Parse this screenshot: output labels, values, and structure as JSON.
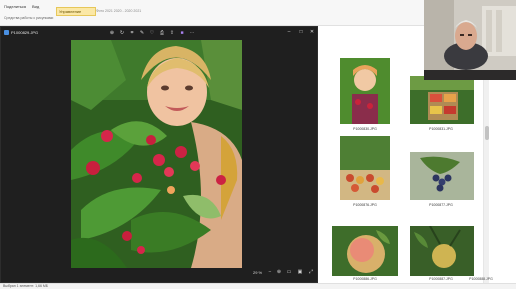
{
  "explorer": {
    "ribbon": {
      "tab1": "Поделиться",
      "tab2": "Вид",
      "highlight_tab": "Управление",
      "path_hint": "Фото 2021 2020 - 2020 2021",
      "sub1": "Средства работы с рисунками"
    },
    "thumbnails": [
      {
        "label": "P1000830.JPG"
      },
      {
        "label": "P1000831.JPG"
      },
      {
        "label": "P1000876.JPG"
      },
      {
        "label": "P1000877.JPG"
      },
      {
        "label": "P1000886.JPG"
      },
      {
        "label": "P1000885.JPG"
      }
    ],
    "bottom_labels": [
      "P1000876.JPG",
      "P1000883.JPG",
      "P1000884.JPG",
      "P1000885.JPG",
      "P1000886.JPG",
      "P1000887.JPG",
      "P1000888.JPG"
    ],
    "status": "Выбран 1 элемент: 1,66 МБ"
  },
  "viewer": {
    "title": "P1000829.JPG",
    "zoom": "29 %",
    "toolbar_icons": [
      "zoom-in-icon",
      "rotate-icon",
      "crop-icon",
      "edit-icon",
      "favorite-icon",
      "print-icon",
      "share-icon",
      "app-icon",
      "more-icon"
    ],
    "window_buttons": [
      "minimize",
      "maximize",
      "close"
    ]
  },
  "colors": {
    "viewer_bg": "#1f1f1f",
    "ribbon_highlight": "#fbe8a6"
  }
}
